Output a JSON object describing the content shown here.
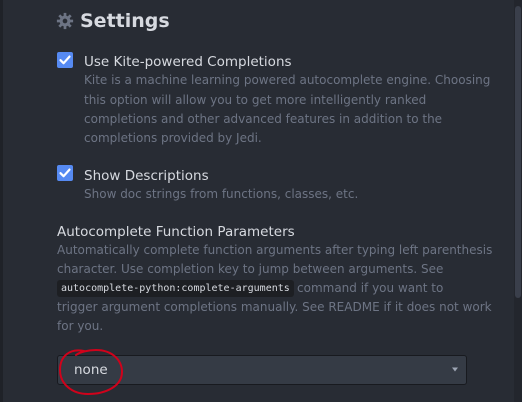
{
  "header": {
    "title": "Settings",
    "icon": "gear-icon"
  },
  "settings": {
    "kite": {
      "label": "Use Kite-powered Completions",
      "checked": true,
      "description": [
        "Kite is a machine learning powered autocomplete engine. Choosing",
        "this option will allow you to get more intelligently ranked",
        "completions and other advanced features in addition to the",
        "completions provided by Jedi."
      ]
    },
    "descriptions": {
      "label": "Show Descriptions",
      "checked": true,
      "description": "Show doc strings from functions, classes, etc."
    },
    "params": {
      "label": "Autocomplete Function Parameters",
      "description_before_code": [
        "Automatically complete function arguments after typing left parenthesis",
        "character. Use completion key to jump between arguments. See"
      ],
      "code": "autocomplete-python:complete-arguments",
      "after_code": "command if you want to",
      "description_after_code": [
        "trigger argument completions manually. See README if it does not work",
        "for you."
      ],
      "selected_value": "none"
    }
  },
  "colors": {
    "background": "#282c34",
    "checkbox": "#568af2",
    "annotation": "#d0021b",
    "text": "#d7dae0",
    "muted": "#6d7484"
  }
}
